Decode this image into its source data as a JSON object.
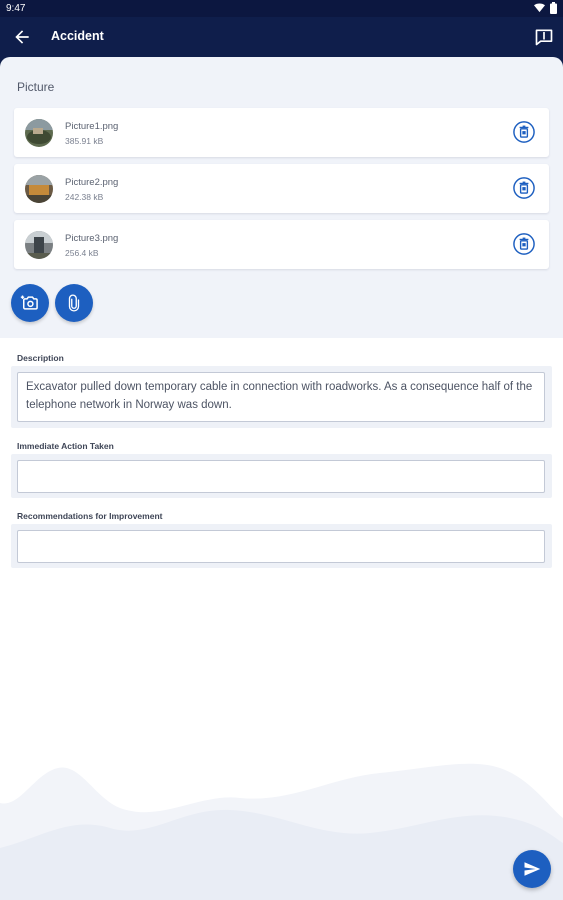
{
  "status_bar": {
    "time": "9:47"
  },
  "app_bar": {
    "title": "Accident"
  },
  "picture_section": {
    "title": "Picture",
    "files": [
      {
        "name": "Picture1.png",
        "size": "385.91 kB"
      },
      {
        "name": "Picture2.png",
        "size": "242.38 kB"
      },
      {
        "name": "Picture3.png",
        "size": "256.4 kB"
      }
    ]
  },
  "form": {
    "description": {
      "label": "Description",
      "value": "Excavator pulled down temporary cable in connection with roadworks. As a consequence half of the telephone network in Norway was down."
    },
    "immediate_action": {
      "label": "Immediate Action Taken",
      "value": ""
    },
    "recommendations": {
      "label": "Recommendations for Improvement",
      "value": ""
    }
  },
  "colors": {
    "primary": "#1d5fc0",
    "app_bar": "#0f1e4b",
    "sheet_bg": "#f0f3f9"
  },
  "icons": [
    "back-arrow-icon",
    "help-book-icon",
    "trash-icon",
    "camera-plus-icon",
    "paperclip-icon",
    "send-icon",
    "wifi-icon",
    "battery-icon"
  ]
}
